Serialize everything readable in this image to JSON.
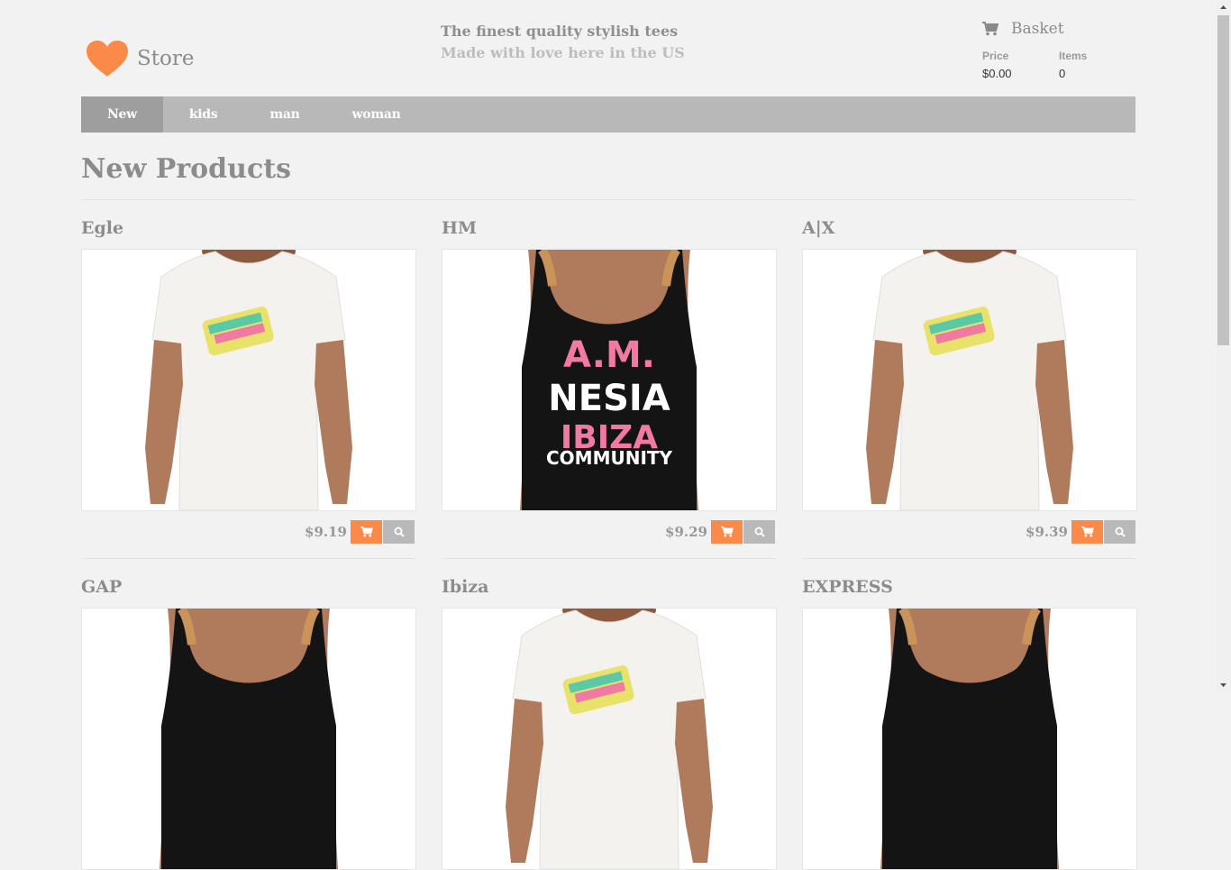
{
  "brand": {
    "name": "Store",
    "logo_icon": "heart-icon",
    "logo_color": "#fb8a48"
  },
  "tagline": {
    "line1": "The finest quality stylish tees",
    "line2": "Made with love here in the US"
  },
  "basket": {
    "title": "Basket",
    "icon": "cart-icon",
    "price_label": "Price",
    "price_value": "$0.00",
    "items_label": "Items",
    "items_value": "0"
  },
  "nav": {
    "items": [
      {
        "label": "New",
        "active": true
      },
      {
        "label": "kids",
        "active": false
      },
      {
        "label": "man",
        "active": false
      },
      {
        "label": "woman",
        "active": false
      }
    ]
  },
  "section": {
    "title": "New Products"
  },
  "products": [
    {
      "name": "Egle",
      "price": "$9.19",
      "shirt": "white-tee"
    },
    {
      "name": "HM",
      "price": "$9.29",
      "shirt": "black-tank"
    },
    {
      "name": "A|X",
      "price": "$9.39",
      "shirt": "white-tee"
    },
    {
      "name": "GAP",
      "price": "",
      "shirt": "black-tank"
    },
    {
      "name": "Ibiza",
      "price": "",
      "shirt": "white-tee"
    },
    {
      "name": "EXPRESS",
      "price": "",
      "shirt": "black-tank"
    }
  ],
  "tank_print": {
    "line1": "A.M.",
    "line2": "NESIA",
    "line3": "IBIZA",
    "line4": "COMMUNITY"
  },
  "colors": {
    "accent": "#fb8a48",
    "nav_bg": "#b8b8b8",
    "nav_active": "#9e9e9e",
    "search_btn": "#b9b9b9"
  }
}
